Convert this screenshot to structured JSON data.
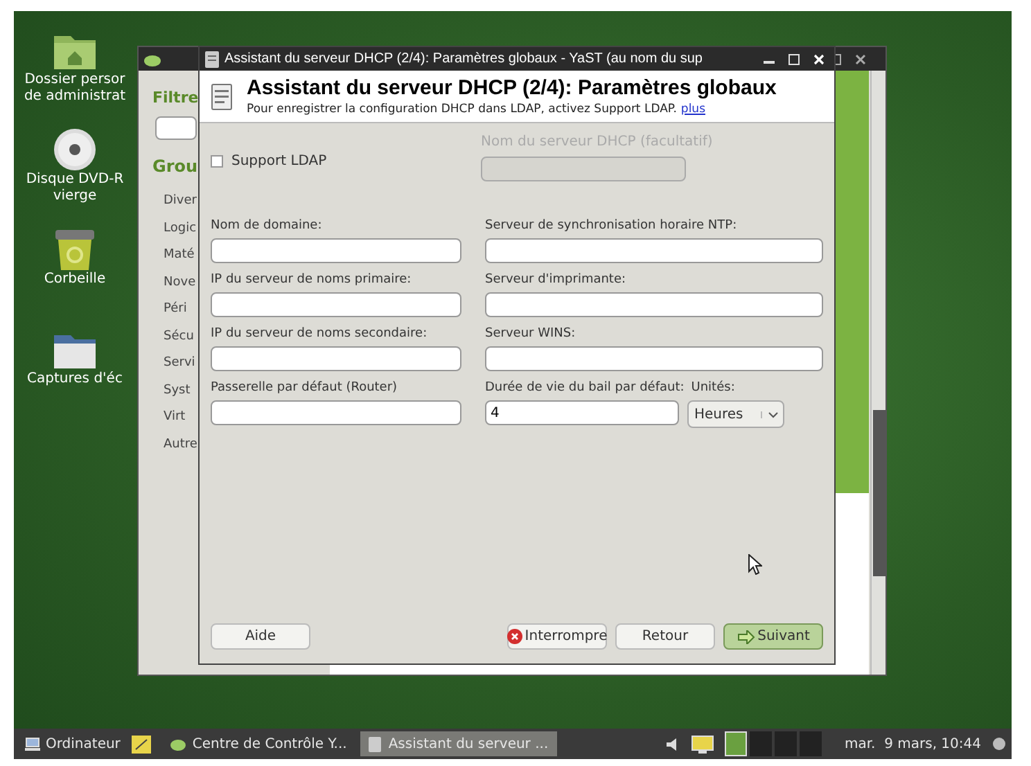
{
  "desktop": {
    "icons": [
      {
        "kind": "home-folder",
        "lines": [
          "Dossier persor",
          "de administrat"
        ]
      },
      {
        "kind": "disc",
        "lines": [
          "Disque DVD-R",
          "vierge"
        ]
      },
      {
        "kind": "trash",
        "lines": [
          "Corbeille"
        ]
      },
      {
        "kind": "folder",
        "lines": [
          "Captures d'éc"
        ]
      }
    ]
  },
  "back_window": {
    "filter_label": "Filtre",
    "groups_label": "Grou",
    "groups": [
      "Diver",
      "Logic",
      "Maté",
      "Nove",
      "Péri",
      "Sécu",
      "Servi",
      "Syst",
      "Virt",
      "Autre"
    ]
  },
  "front_window": {
    "title": "Assistant du serveur DHCP (2/4): Paramètres globaux - YaST (au nom du sup",
    "header": {
      "title": "Assistant du serveur DHCP (2/4): Paramètres globaux",
      "subtitle": "Pour enregistrer la configuration DHCP dans LDAP, activez Support LDAP.",
      "link": "plus"
    },
    "ldap": {
      "label": "Support LDAP",
      "checked": false
    },
    "dhcp_server": {
      "label": "Nom du serveur DHCP (facultatif)",
      "disabled": true
    },
    "fields": [
      {
        "kind": "text",
        "label": "Nom de domaine:"
      },
      {
        "kind": "text",
        "label": "Serveur de synchronisation horaire  NTP:"
      },
      {
        "kind": "text",
        "label": "IP du serveur de noms primaire:"
      },
      {
        "kind": "text",
        "label": "Serveur d'imprimante:"
      },
      {
        "kind": "text",
        "label": "IP du serveur de noms secondaire:"
      },
      {
        "kind": "text",
        "label": "Serveur WINS:"
      },
      {
        "kind": "text",
        "label": "Passerelle par défaut (Router)"
      },
      {
        "kind": "lease",
        "label": "Durée de vie du bail par défaut:",
        "value": "4",
        "units_label": "Unités:",
        "units": "Heures"
      }
    ],
    "buttons": [
      {
        "kind": "help",
        "label": "Aide"
      },
      {
        "kind": "abort",
        "label": "Interrompre"
      },
      {
        "kind": "back",
        "label": "Retour"
      },
      {
        "kind": "next",
        "label": "Suivant"
      }
    ]
  },
  "taskbar": {
    "start": "Ordinateur",
    "tasks": [
      {
        "kind": "control-center",
        "label": "Centre de Contrôle Y...",
        "selected": false
      },
      {
        "kind": "wizard",
        "label": "Assistant du serveur ...",
        "selected": true
      }
    ],
    "clock": "mar.  9 mars, 10:44"
  }
}
